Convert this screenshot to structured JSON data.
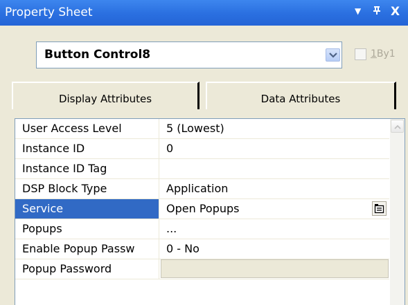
{
  "window": {
    "title": "Property Sheet",
    "controls": {
      "dropdown": "▼",
      "pin": "ᵽ",
      "close": "X"
    }
  },
  "object_selector": {
    "value": "Button Control8"
  },
  "checkbox": {
    "label_prefix": "1",
    "label_rest": "By1",
    "checked": false
  },
  "tabs": [
    {
      "label": "Display Attributes",
      "active": false
    },
    {
      "label": "Data Attributes",
      "active": true
    }
  ],
  "properties": [
    {
      "name": "User Access Level",
      "value": "5 (Lowest)"
    },
    {
      "name": "Instance ID",
      "value": "0"
    },
    {
      "name": "Instance ID Tag",
      "value": ""
    },
    {
      "name": "DSP Block Type",
      "value": "Application"
    },
    {
      "name": "Service",
      "value": "Open Popups"
    },
    {
      "name": "Popups",
      "value": "..."
    },
    {
      "name": "Enable Popup Passw",
      "value": "0 - No"
    },
    {
      "name": "Popup Password",
      "value": ""
    }
  ],
  "colors": {
    "titlebar": "#2a6fe0",
    "selection": "#316ac5",
    "panel": "#ece9d8"
  },
  "icons": {
    "dropdown_button": "chevron-down-icon",
    "service_button": "list-picker-icon",
    "scroll_up": "chevron-up-icon"
  }
}
